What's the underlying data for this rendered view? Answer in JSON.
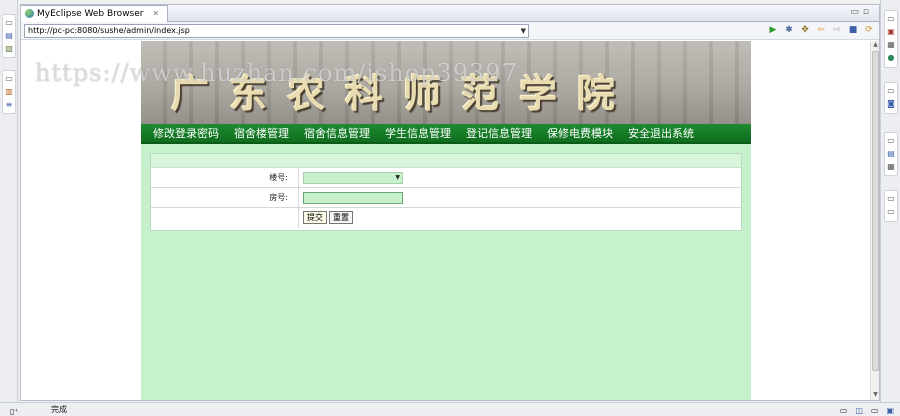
{
  "browser": {
    "tab_title": "MyEclipse Web Browser",
    "tab_close_icon": "close-icon",
    "url": "http://pc-pc:8080/sushe/admin/index.jsp",
    "nav_icons": [
      "run-icon",
      "gear-icon",
      "tools-icon",
      "back-icon",
      "forward-icon",
      "stop-icon",
      "refresh-icon"
    ]
  },
  "watermark": "https://www.huzhan.com/ishop39397",
  "banner": {
    "title": "广东农科师范学院"
  },
  "nav": {
    "items": [
      "修改登录密码",
      "宿舍楼管理",
      "宿舍信息管理",
      "学生信息管理",
      "登记信息管理",
      "保修电费模块",
      "安全退出系统"
    ]
  },
  "form": {
    "building_label": "楼号:",
    "building_value": "",
    "room_label": "房号:",
    "room_value": "",
    "submit_label": "提交",
    "reset_label": "重置"
  },
  "status": {
    "text": "完成"
  },
  "colors": {
    "nav_green": "#1e8b31",
    "page_bg": "#c7f0cd"
  }
}
